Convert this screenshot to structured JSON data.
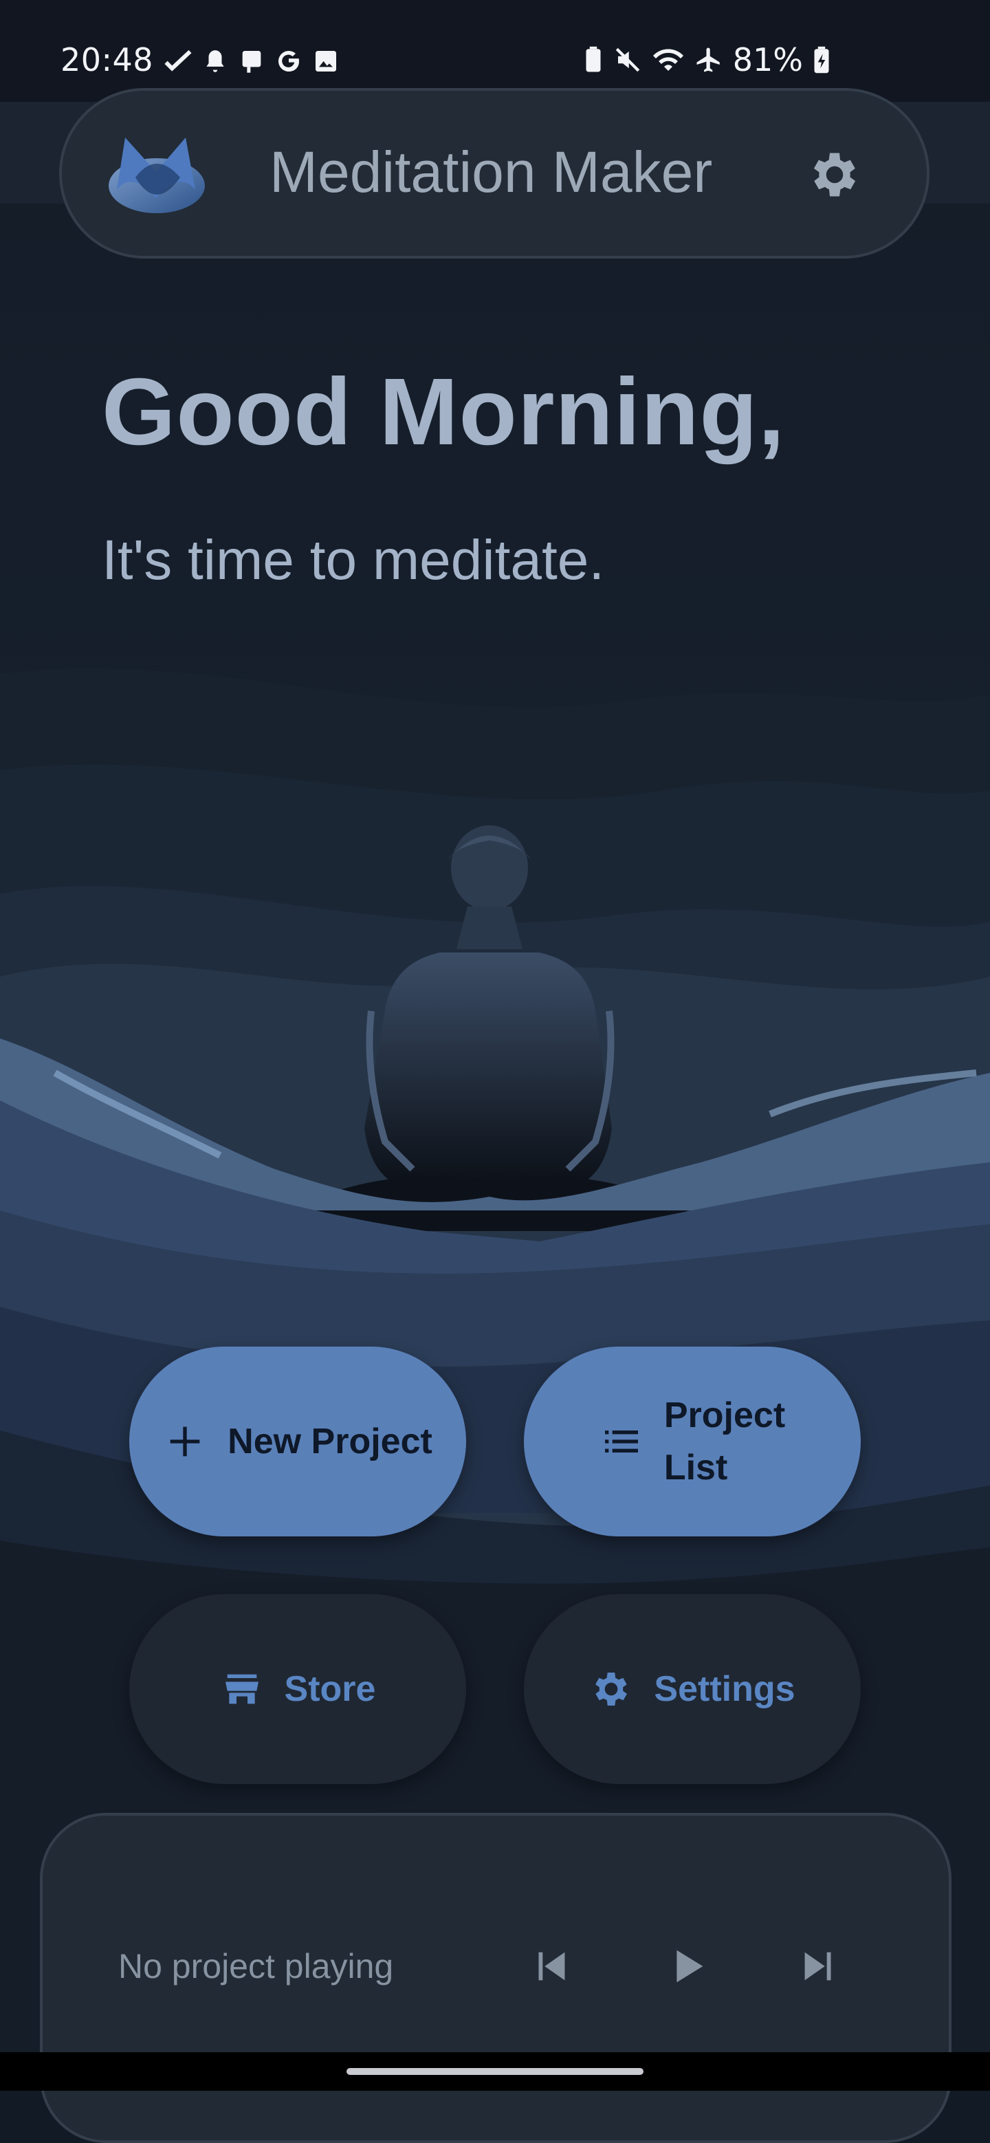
{
  "status_bar": {
    "time": "20:48",
    "battery": "81%",
    "left_icons": [
      "check-icon",
      "notification-bell-icon",
      "device-icon",
      "google-icon",
      "image-icon"
    ],
    "right_icons": [
      "battery-saver-icon",
      "mute-icon",
      "wifi-icon",
      "airplane-icon",
      "battery-icon"
    ]
  },
  "header": {
    "title": "Meditation Maker",
    "logo_icon": "app-logo-icon",
    "settings_icon": "gear-icon"
  },
  "hero": {
    "greeting": "Good Morning,",
    "subtitle": "It's time to meditate."
  },
  "actions": {
    "new_project": "New Project",
    "project_list": "Project\nList",
    "store": "Store",
    "settings": "Settings"
  },
  "player": {
    "status": "No project playing",
    "controls": [
      "skip-previous-icon",
      "play-icon",
      "skip-next-icon"
    ]
  },
  "colors": {
    "background": "#121a25",
    "primary_button": "#5a80b8",
    "secondary_button": "#1f2732",
    "accent_text": "#5a86c4",
    "heading_text": "#a4b3c8"
  }
}
